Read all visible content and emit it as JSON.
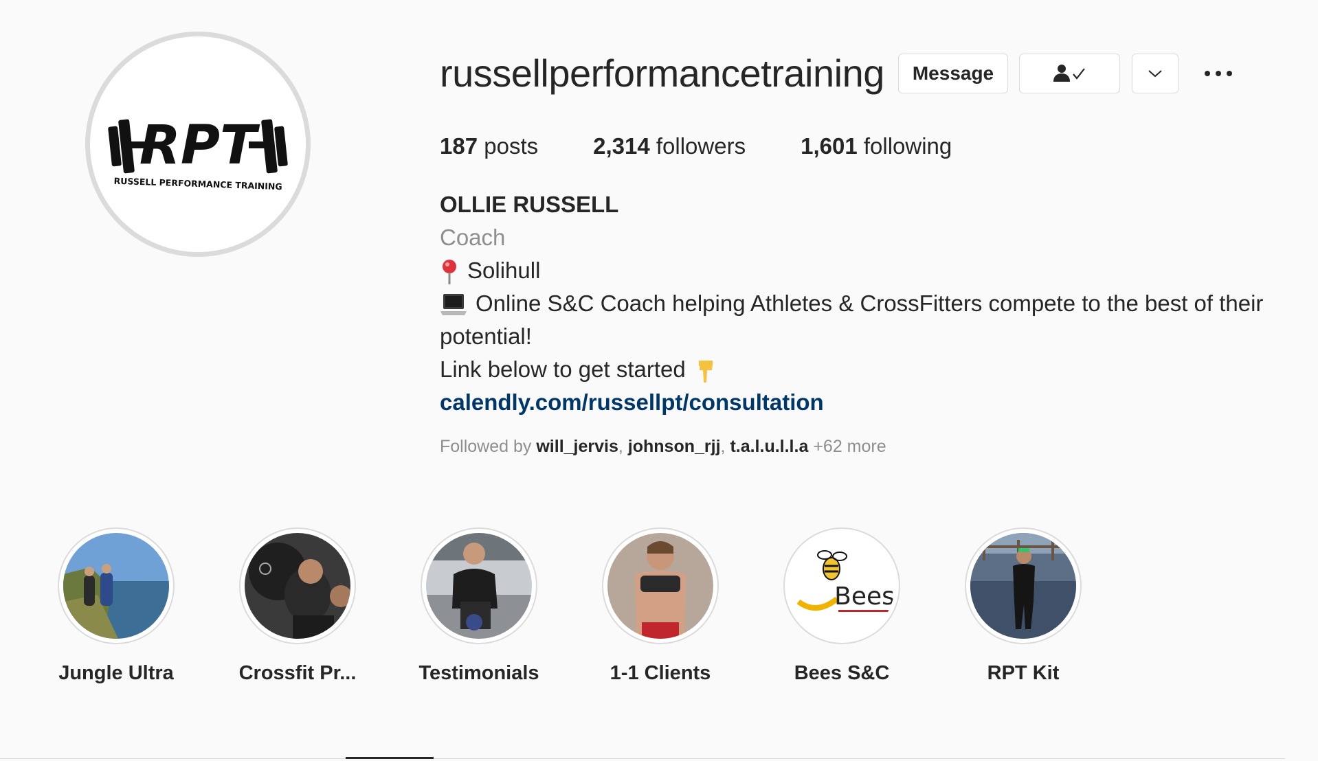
{
  "profile": {
    "username": "russellperformancetraining",
    "logo_text": "RPT",
    "logo_subtitle": "RUSSELL PERFORMANCE TRAINING"
  },
  "actions": {
    "message_label": "Message",
    "following_icon": "person-check-icon",
    "suggest_icon": "chevron-down-icon",
    "more_icon": "more-dots-icon"
  },
  "stats": {
    "posts_count": "187",
    "posts_label": "posts",
    "followers_count": "2,314",
    "followers_label": "followers",
    "following_count": "1,601",
    "following_label": "following"
  },
  "bio": {
    "name": "OLLIE RUSSELL",
    "category": "Coach",
    "location": "Solihull",
    "location_icon": "pin-icon",
    "line2": "Online S&C Coach helping Athletes & CrossFitters compete to the best of their potential!",
    "line2_icon": "laptop-icon",
    "line3": "Link below to get started",
    "line3_icon": "pointing-down-icon",
    "link": "calendly.com/russellpt/consultation"
  },
  "followed_by": {
    "prefix": "Followed by",
    "users": [
      "will_jervis",
      "johnson_rjj",
      "t.a.l.u.l.l.a"
    ],
    "more": "+62 more"
  },
  "highlights": [
    {
      "label": "Jungle Ultra"
    },
    {
      "label": "Crossfit Pr..."
    },
    {
      "label": "Testimonials"
    },
    {
      "label": "1-1 Clients"
    },
    {
      "label": "Bees S&C",
      "logo_text": "Bees"
    },
    {
      "label": "RPT Kit"
    }
  ],
  "colors": {
    "link": "#00376b",
    "secondary_text": "#8e8e8e",
    "border": "#dbdbdb",
    "background": "#fafafa"
  }
}
